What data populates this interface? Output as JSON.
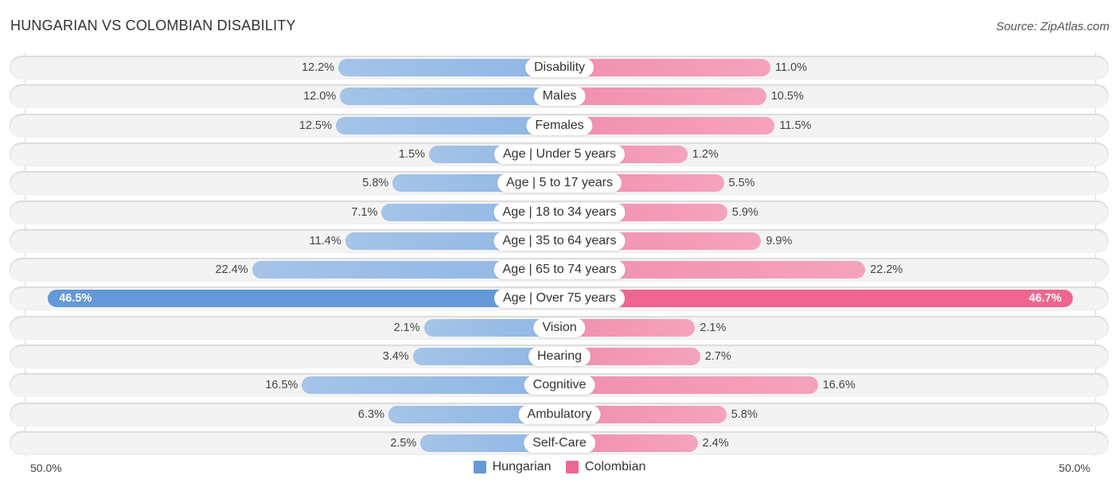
{
  "header": {
    "title": "HUNGARIAN VS COLOMBIAN DISABILITY",
    "source": "Source: ZipAtlas.com"
  },
  "colors": {
    "hungarian": "#a4c4e8",
    "hungarian_strong": "#6399d8",
    "colombian": "#f5a3bd",
    "colombian_strong": "#ef6791"
  },
  "chart_data": {
    "type": "bar",
    "orientation": "horizontal-diverging",
    "title": "HUNGARIAN VS COLOMBIAN DISABILITY",
    "categories": [
      "Disability",
      "Males",
      "Females",
      "Age | Under 5 years",
      "Age | 5 to 17 years",
      "Age | 18 to 34 years",
      "Age | 35 to 64 years",
      "Age | 65 to 74 years",
      "Age | Over 75 years",
      "Vision",
      "Hearing",
      "Cognitive",
      "Ambulatory",
      "Self-Care"
    ],
    "series": [
      {
        "name": "Hungarian",
        "side": "left",
        "values": [
          12.2,
          12.0,
          12.5,
          1.5,
          5.8,
          7.1,
          11.4,
          22.4,
          46.5,
          2.1,
          3.4,
          16.5,
          6.3,
          2.5
        ]
      },
      {
        "name": "Colombian",
        "side": "right",
        "values": [
          11.0,
          10.5,
          11.5,
          1.2,
          5.5,
          5.9,
          9.9,
          22.2,
          46.7,
          2.1,
          2.7,
          16.6,
          5.8,
          2.4
        ]
      }
    ],
    "value_labels_left": [
      "12.2%",
      "12.0%",
      "12.5%",
      "1.5%",
      "5.8%",
      "7.1%",
      "11.4%",
      "22.4%",
      "46.5%",
      "2.1%",
      "3.4%",
      "16.5%",
      "6.3%",
      "2.5%"
    ],
    "value_labels_right": [
      "11.0%",
      "10.5%",
      "11.5%",
      "1.2%",
      "5.5%",
      "5.9%",
      "9.9%",
      "22.2%",
      "46.7%",
      "2.1%",
      "2.7%",
      "16.6%",
      "5.8%",
      "2.4%"
    ],
    "highlighted_category": "Age | Over 75 years",
    "xlim": [
      -50,
      50
    ],
    "axis_min_label": "50.0%",
    "axis_max_label": "50.0%",
    "legend": [
      "Hungarian",
      "Colombian"
    ],
    "legend_position": "bottom-center",
    "grid": false,
    "unit": "%"
  }
}
